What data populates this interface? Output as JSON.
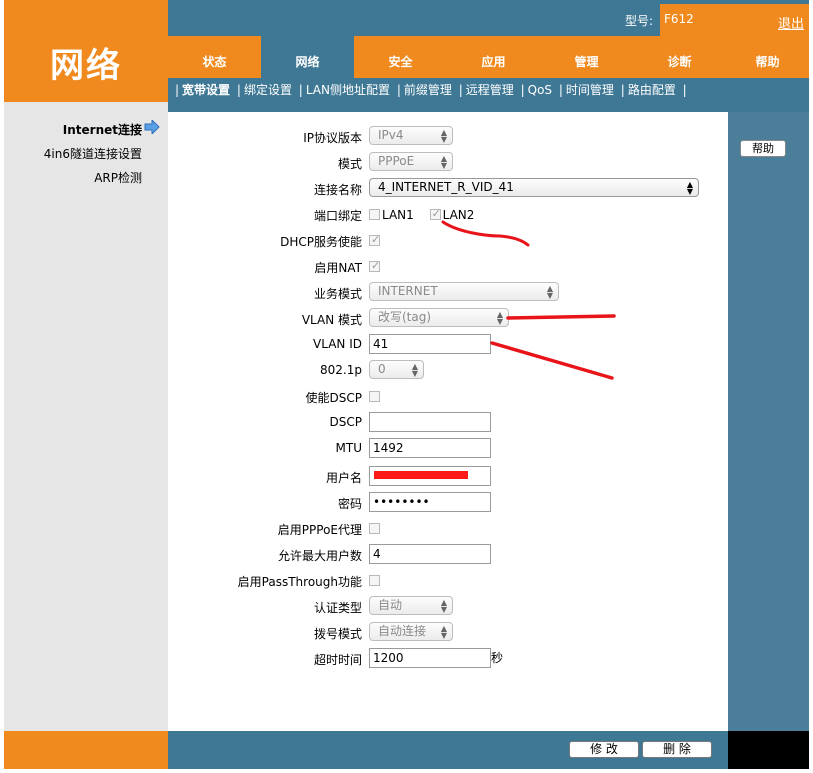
{
  "brand": {
    "title": "网络"
  },
  "header": {
    "model_label": "型号:",
    "model_value": "F612",
    "logout": "退出"
  },
  "nav": {
    "tabs": [
      "状态",
      "网络",
      "安全",
      "应用",
      "管理",
      "诊断",
      "帮助"
    ],
    "active": "网络"
  },
  "subnav": {
    "items": [
      "宽带设置",
      "绑定设置",
      "LAN侧地址配置",
      "前缀管理",
      "远程管理",
      "QoS",
      "时间管理",
      "路由配置"
    ],
    "active": "宽带设置"
  },
  "sidebar": {
    "items": [
      "Internet连接",
      "4in6隧道连接设置",
      "ARP检测"
    ],
    "active": "Internet连接"
  },
  "help_button": "帮助",
  "form": {
    "ip_version": {
      "label": "IP协议版本",
      "value": "IPv4"
    },
    "mode": {
      "label": "模式",
      "value": "PPPoE"
    },
    "conn_name": {
      "label": "连接名称",
      "value": "4_INTERNET_R_VID_41"
    },
    "port_bind": {
      "label": "端口绑定",
      "lan1": "LAN1",
      "lan2": "LAN2",
      "lan1_checked": false,
      "lan2_checked": true
    },
    "dhcp": {
      "label": "DHCP服务使能",
      "checked": true
    },
    "nat": {
      "label": "启用NAT",
      "checked": true
    },
    "service_mode": {
      "label": "业务模式",
      "value": "INTERNET"
    },
    "vlan_mode": {
      "label": "VLAN 模式",
      "value": "改写(tag)"
    },
    "vlan_id": {
      "label": "VLAN ID",
      "value": "41"
    },
    "dot1p": {
      "label": "802.1p",
      "value": "0"
    },
    "dscp_enable": {
      "label": "使能DSCP",
      "checked": false
    },
    "dscp": {
      "label": "DSCP",
      "value": ""
    },
    "mtu": {
      "label": "MTU",
      "value": "1492"
    },
    "username": {
      "label": "用户名"
    },
    "password": {
      "label": "密码",
      "value": "••••••••"
    },
    "pppoe_proxy": {
      "label": "启用PPPoE代理",
      "checked": false
    },
    "max_users": {
      "label": "允许最大用户数",
      "value": "4"
    },
    "passthrough": {
      "label": "启用PassThrough功能",
      "checked": false
    },
    "auth_type": {
      "label": "认证类型",
      "value": "自动"
    },
    "dial_mode": {
      "label": "拨号模式",
      "value": "自动连接"
    },
    "timeout": {
      "label": "超时时间",
      "value": "1200",
      "unit": "秒"
    }
  },
  "footer": {
    "modify": "修 改",
    "delete": "删 除"
  },
  "colors": {
    "orange": "#f08a1e",
    "blue": "#3f7895",
    "annotation_red": "#e8141a"
  }
}
